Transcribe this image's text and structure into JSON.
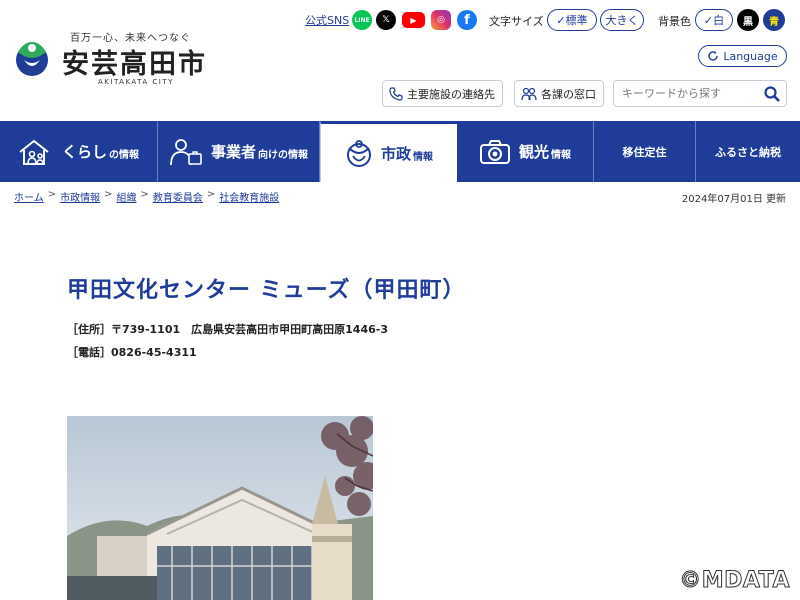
{
  "header": {
    "logo_tagline": "百万一心、未来へつなぐ",
    "logo_name": "安芸高田市",
    "logo_en": "AKITAKATA CITY",
    "sns_label": "公式SNS",
    "sns": [
      {
        "name": "line",
        "label": "LINE"
      },
      {
        "name": "x",
        "label": "𝕏"
      },
      {
        "name": "youtube",
        "label": "▶"
      },
      {
        "name": "instagram",
        "label": "◎"
      },
      {
        "name": "facebook",
        "label": "f"
      }
    ],
    "font_size_label": "文字サイズ",
    "font_standard": "標準",
    "font_large": "大きく",
    "bg_color_label": "背景色",
    "bg_white": "白",
    "bg_black": "黒",
    "bg_blue": "青",
    "language": "Language",
    "contact_label": "主要施設の連絡先",
    "window_label": "各課の窓口",
    "search_placeholder": "キーワードから探す"
  },
  "nav": {
    "kurashi_big": "くらし",
    "kurashi_small": "の情報",
    "biz_big": "事業者",
    "biz_small": "向けの情報",
    "shisei_big": "市政",
    "shisei_small": "情報",
    "kanko_big": "観光",
    "kanko_small": "情報",
    "ijyu": "移住定住",
    "furusato": "ふるさと納税"
  },
  "breadcrumb": {
    "items": [
      "ホーム",
      "市政情報",
      "組織",
      "教育委員会",
      "社会教育施設"
    ],
    "separator": ">"
  },
  "updated": "2024年07月01日 更新",
  "content": {
    "title": "甲田文化センター ミューズ（甲田町）",
    "address": "［住所］〒739-1101　広島県安芸高田市甲田町高田原1446-3",
    "tel": "［電話］0826-45-4311"
  },
  "watermark": "©MDATA",
  "colors": {
    "brand_blue": "#1f3c99",
    "nav_active_bg": "#ffffff"
  }
}
